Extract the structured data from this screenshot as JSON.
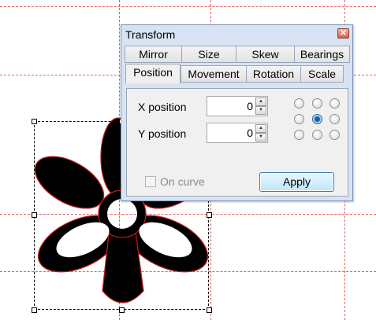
{
  "dialog": {
    "title": "Transform",
    "close_glyph": "✕",
    "tabs_row_back": [
      "Mirror",
      "Size",
      "Skew",
      "Bearings"
    ],
    "tabs_row_front": [
      "Position",
      "Movement",
      "Rotation",
      "Scale"
    ],
    "active_tab": "Position",
    "x_label": "X position",
    "x_value": "0",
    "y_label": "Y position",
    "y_value": "0",
    "on_curve_label": "On curve",
    "on_curve_checked": false,
    "on_curve_enabled": false,
    "apply_label": "Apply",
    "anchor_selected": "center"
  },
  "canvas": {
    "glyph": "flower-shape",
    "guide_color": "#e06060"
  }
}
